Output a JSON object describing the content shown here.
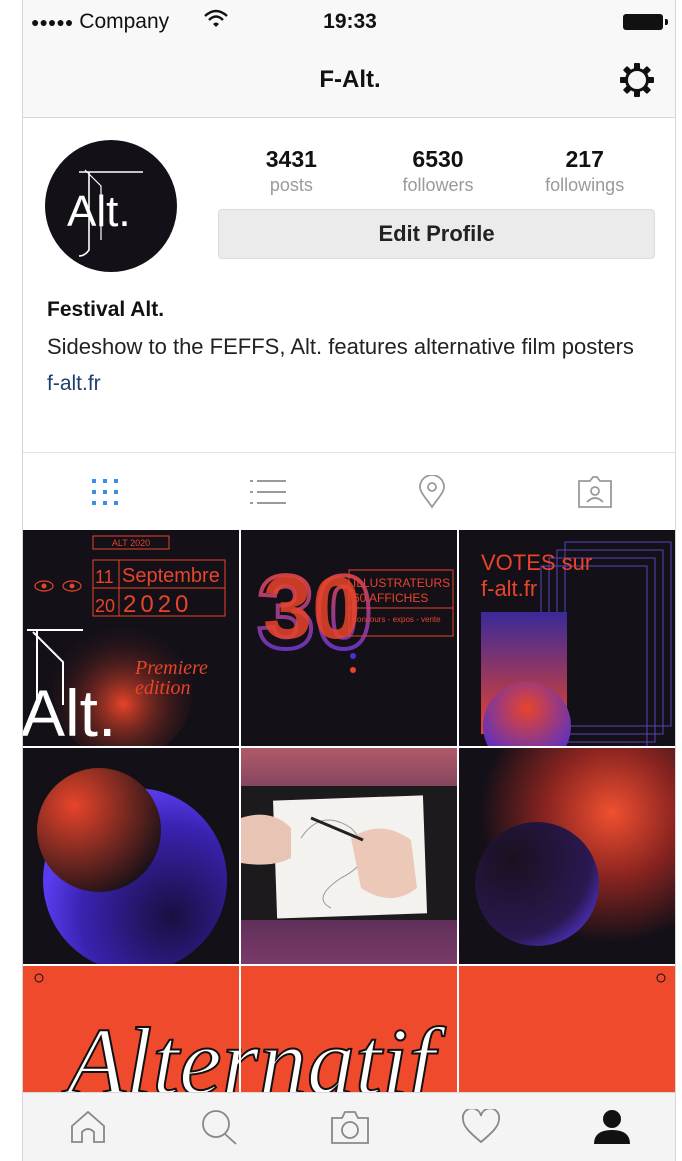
{
  "status_bar": {
    "carrier": "Company",
    "time": "19:33"
  },
  "nav": {
    "title": "F-Alt."
  },
  "profile": {
    "avatar_text": "Alt.",
    "stats": [
      {
        "value": "3431",
        "label": "posts"
      },
      {
        "value": "6530",
        "label": "followers"
      },
      {
        "value": "217",
        "label": "followings"
      }
    ],
    "edit_label": "Edit Profile",
    "name": "Festival Alt.",
    "bio": "Sideshow to the FEFFS, Alt. features alternative film posters",
    "link": "f-alt.fr"
  },
  "tabs": [
    {
      "icon": "grid-icon",
      "active": true
    },
    {
      "icon": "list-icon",
      "active": false
    },
    {
      "icon": "location-pin-icon",
      "active": false
    },
    {
      "icon": "tagged-person-icon",
      "active": false
    }
  ],
  "posts": {
    "p1": {
      "tag": "ALT 2020",
      "date_top": "11",
      "date_bottom": "20",
      "month": "Septembre",
      "year": "2020",
      "word": "Alt.",
      "line1": "Premiere",
      "line2": "edition"
    },
    "p2": {
      "number": "30",
      "line1": "ILLUSTRATEURS",
      "line2": "60 AFFICHES",
      "line3": "concours - expos - vente"
    },
    "p3": {
      "line1": "VOTES sur",
      "line2": "f-alt.fr"
    },
    "p7": {
      "word": "Alternatif"
    }
  },
  "bottom_nav": [
    {
      "icon": "home-icon"
    },
    {
      "icon": "search-icon"
    },
    {
      "icon": "camera-icon"
    },
    {
      "icon": "heart-icon"
    },
    {
      "icon": "profile-icon"
    }
  ],
  "colors": {
    "accent_blue": "#3a8ee6",
    "poster_red": "#e8442a",
    "poster_dark": "#141018",
    "poster_purple": "#4a2fd6"
  }
}
